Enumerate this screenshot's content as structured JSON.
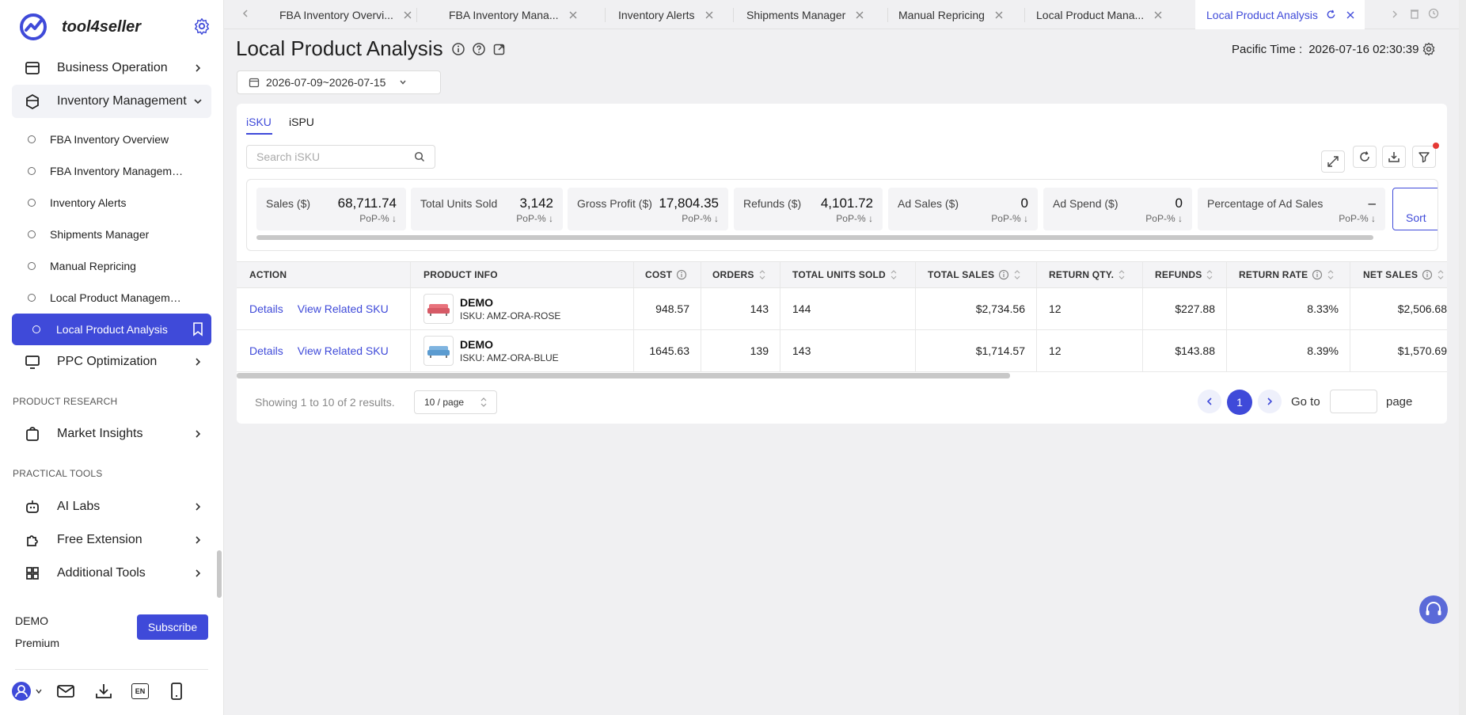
{
  "brand": {
    "name": "tool4seller"
  },
  "sidebar": {
    "top_items": [
      {
        "label": "Business Operation"
      },
      {
        "label": "Inventory Management"
      }
    ],
    "sub_items": [
      {
        "label": "FBA Inventory Overview"
      },
      {
        "label": "FBA Inventory Management"
      },
      {
        "label": "Inventory Alerts"
      },
      {
        "label": "Shipments Manager"
      },
      {
        "label": "Manual Repricing"
      },
      {
        "label": "Local Product Management"
      },
      {
        "label": "Local Product Analysis"
      }
    ],
    "ppc": {
      "label": "PPC Optimization"
    },
    "section_research": "PRODUCT RESEARCH",
    "market": {
      "label": "Market Insights"
    },
    "section_tools": "PRACTICAL TOOLS",
    "tools": [
      {
        "label": "AI Labs"
      },
      {
        "label": "Free Extension"
      },
      {
        "label": "Additional Tools"
      }
    ],
    "user": {
      "name": "DEMO",
      "plan": "Premium"
    },
    "subscribe_label": "Subscribe",
    "lang_badge": "EN"
  },
  "tabs": [
    {
      "label": "FBA Inventory Overvi..."
    },
    {
      "label": "FBA Inventory Mana..."
    },
    {
      "label": "Inventory Alerts"
    },
    {
      "label": "Shipments Manager"
    },
    {
      "label": "Manual Repricing"
    },
    {
      "label": "Local Product Mana..."
    },
    {
      "label": "Local Product Analysis"
    }
  ],
  "page": {
    "title": "Local Product Analysis",
    "pacific_label": "Pacific Time :",
    "pacific_time": "2026-07-16 02:30:39",
    "date_range": "2026-07-09~2026-07-15"
  },
  "subtabs": [
    "iSKU",
    "iSPU"
  ],
  "search": {
    "placeholder": "Search iSKU"
  },
  "metrics": [
    {
      "label": "Sales ($)",
      "value": "68,711.74",
      "pop": "PoP-%"
    },
    {
      "label": "Total Units Sold",
      "value": "3,142",
      "pop": "PoP-%"
    },
    {
      "label": "Gross Profit ($)",
      "value": "17,804.35",
      "pop": "PoP-%"
    },
    {
      "label": "Refunds ($)",
      "value": "4,101.72",
      "pop": "PoP-%"
    },
    {
      "label": "Ad Sales ($)",
      "value": "0",
      "pop": "PoP-%"
    },
    {
      "label": "Ad Spend ($)",
      "value": "0",
      "pop": "PoP-%"
    },
    {
      "label": "Percentage of Ad Sales",
      "value": "–",
      "pop": "PoP-%"
    }
  ],
  "sort_label": "Sort",
  "table": {
    "headers": [
      "ACTION",
      "PRODUCT INFO",
      "COST",
      "ORDERS",
      "TOTAL UNITS SOLD",
      "TOTAL SALES",
      "RETURN QTY.",
      "REFUNDS",
      "RETURN RATE",
      "NET SALES"
    ],
    "action_details": "Details",
    "action_related": "View Related SKU",
    "rows": [
      {
        "name": "DEMO",
        "sku": "ISKU: AMZ-ORA-ROSE",
        "cost": "948.57",
        "orders": "143",
        "units": "144",
        "sales": "$2,734.56",
        "return_qty": "12",
        "refunds": "$227.88",
        "return_rate": "8.33%",
        "net_sales": "$2,506.68"
      },
      {
        "name": "DEMO",
        "sku": "ISKU: AMZ-ORA-BLUE",
        "cost": "1645.63",
        "orders": "139",
        "units": "143",
        "sales": "$1,714.57",
        "return_qty": "12",
        "refunds": "$143.88",
        "return_rate": "8.39%",
        "net_sales": "$1,570.69"
      }
    ]
  },
  "pagination": {
    "showing": "Showing 1 to 10 of 2 results.",
    "page_size": "10 / page",
    "current": "1",
    "goto_label": "Go to",
    "page_label": "page"
  },
  "colors": {
    "accent": "#3f4ad9",
    "notice": "#e53935"
  }
}
